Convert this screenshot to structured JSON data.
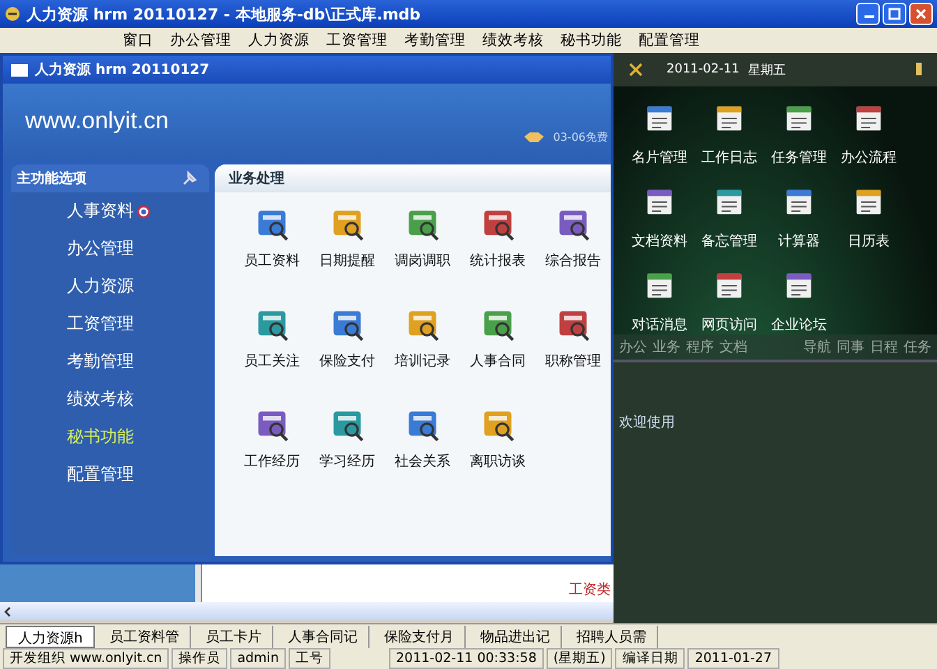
{
  "window": {
    "title": "人力资源 hrm 20110127 - 本地服务-db\\正式库.mdb"
  },
  "menu": [
    "窗口",
    "办公管理",
    "人力资源",
    "工资管理",
    "考勤管理",
    "绩效考核",
    "秘书功能",
    "配置管理"
  ],
  "inner_window": {
    "title": "人力资源 hrm 20110127",
    "site": "www.onlyit.cn",
    "notice": "03-06免费"
  },
  "sidebar": {
    "title": "主功能选项",
    "items": [
      {
        "label": "人事资料",
        "selected": false,
        "marked": true
      },
      {
        "label": "办公管理",
        "selected": false,
        "marked": false
      },
      {
        "label": "人力资源",
        "selected": false,
        "marked": false
      },
      {
        "label": "工资管理",
        "selected": false,
        "marked": false
      },
      {
        "label": "考勤管理",
        "selected": false,
        "marked": false
      },
      {
        "label": "绩效考核",
        "selected": false,
        "marked": false
      },
      {
        "label": "秘书功能",
        "selected": true,
        "marked": false
      },
      {
        "label": "配置管理",
        "selected": false,
        "marked": false
      }
    ]
  },
  "panel": {
    "title": "业务处理",
    "items": [
      "员工资料",
      "日期提醒",
      "调岗调职",
      "统计报表",
      "综合报告",
      "员工关注",
      "保险支付",
      "培训记录",
      "人事合同",
      "职称管理",
      "工作经历",
      "学习经历",
      "社会关系",
      "离职访谈"
    ]
  },
  "desk": {
    "date": "2011-02-11",
    "weekday": "星期五",
    "apps": [
      "名片管理",
      "工作日志",
      "任务管理",
      "办公流程",
      "文档资料",
      "备忘管理",
      "计算器",
      "日历表",
      "对话消息",
      "网页访问",
      "企业论坛"
    ],
    "tabs_left": [
      "办公",
      "业务",
      "程序",
      "文档"
    ],
    "tabs_right": [
      "导航",
      "同事",
      "日程",
      "任务"
    ],
    "welcome": "欢迎使用"
  },
  "background_window": {
    "text": "工资类"
  },
  "window_tabs": [
    {
      "label": "人力资源h",
      "selected": true
    },
    {
      "label": "员工资料管",
      "selected": false
    },
    {
      "label": "员工卡片",
      "selected": false
    },
    {
      "label": "人事合同记",
      "selected": false
    },
    {
      "label": "保险支付月",
      "selected": false
    },
    {
      "label": "物品进出记",
      "selected": false
    },
    {
      "label": "招聘人员需",
      "selected": false
    }
  ],
  "status_bar": [
    "开发组织 www.onlyit.cn",
    "操作员",
    "admin",
    "工号",
    "2011-02-11 00:33:58",
    "(星期五)",
    "编译日期",
    "2011-01-27"
  ]
}
